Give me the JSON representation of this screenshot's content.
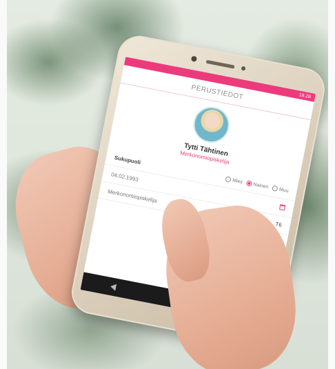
{
  "status_bar": {
    "right_text": "18.28"
  },
  "app_bar": {
    "title": "PERUSTIEDOT"
  },
  "profile": {
    "name": "Tytti Tähtinen",
    "role": "Merkonomiopiskelija"
  },
  "form": {
    "gender": {
      "label": "Sukupuoli",
      "options": [
        "Mies",
        "Nainen",
        "Muu"
      ],
      "selected": "Nainen"
    },
    "birthdate": {
      "value": "04.02.1993"
    },
    "program": {
      "value": "Merkonomiopiskelija",
      "trailing": "T6"
    }
  },
  "pager": {
    "count": 4,
    "active_index": 2
  },
  "colors": {
    "accent": "#ec3b7c",
    "navbar": "#1b1b1b"
  }
}
